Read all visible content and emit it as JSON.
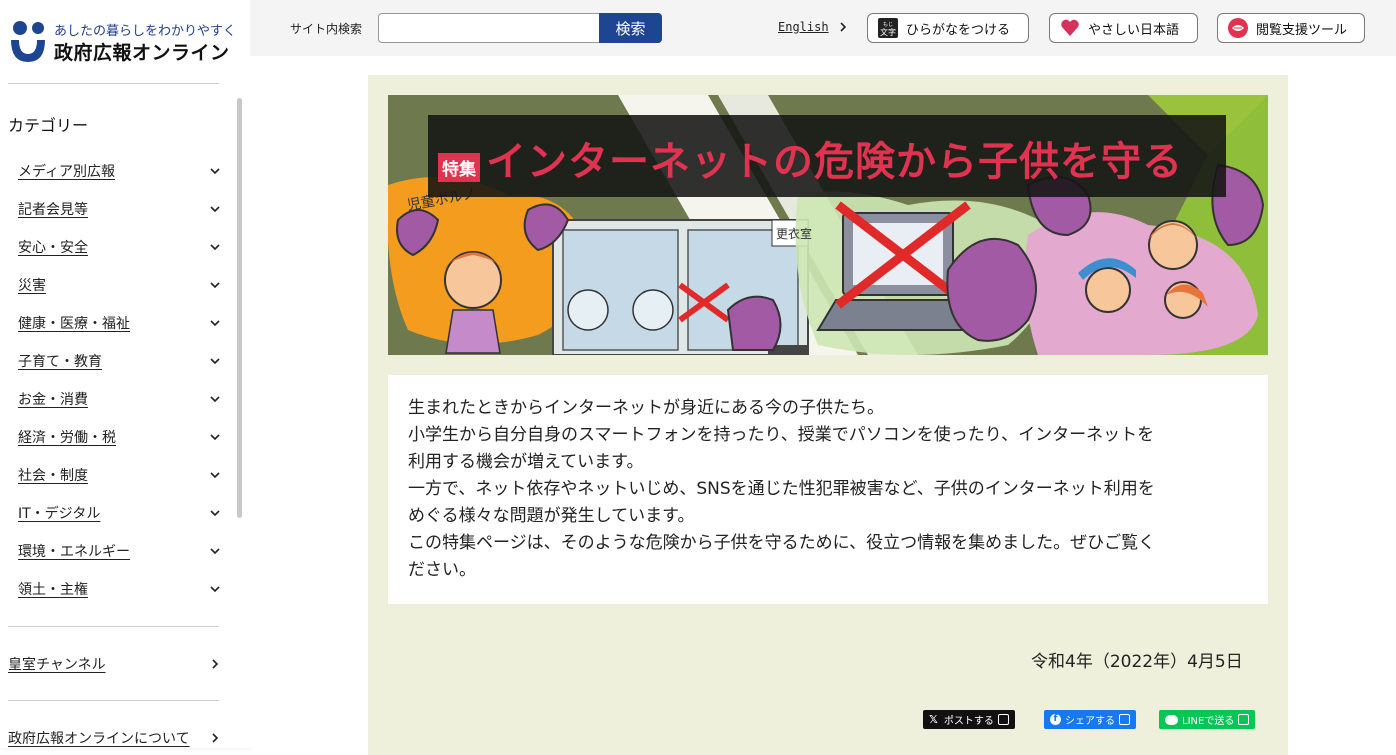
{
  "site": {
    "tagline": "あしたの暮らしをわかりやすく",
    "name": "政府広報オンライン"
  },
  "header": {
    "search_label": "サイト内検索",
    "search_placeholder": "",
    "search_button": "検索",
    "english_link": "English",
    "tools": [
      {
        "label": "ひらがなをつける",
        "icon": "hiragana-moji-icon"
      },
      {
        "label": "やさしい日本語",
        "icon": "heart-icon"
      },
      {
        "label": "閲覧支援ツール",
        "icon": "lips-icon"
      }
    ]
  },
  "sidebar": {
    "category_heading": "カテゴリー",
    "categories": [
      "メディア別広報",
      "記者会見等",
      "安心・安全",
      "災害",
      "健康・医療・福祉",
      "子育て・教育",
      "お金・消費",
      "経済・労働・税",
      "社会・制度",
      "IT・デジタル",
      "環境・エネルギー",
      "領土・主権"
    ],
    "imperial_channel": "皇室チャンネル",
    "about": "政府広報オンラインについて"
  },
  "banner": {
    "badge": "特集",
    "title": "インターネットの危険から子供を守る",
    "sign_left": "児童ポルノ",
    "sign_mid": "更衣室"
  },
  "intro": {
    "lines": [
      "生まれたときからインターネットが身近にある今の子供たち。",
      "小学生から自分自身のスマートフォンを持ったり、授業でパソコンを使ったり、インターネットを",
      "利用する機会が増えています。",
      "一方で、ネット依存やネットいじめ、SNSを通じた性犯罪被害など、子供のインターネット利用を",
      "めぐる様々な問題が発生しています。",
      "この特集ページは、そのような危険から子供を守るために、役立つ情報を集めました。ぜひご覧く",
      "ださい。"
    ]
  },
  "date": "令和4年（2022年）4月5日",
  "share": {
    "x_post": "ポストする",
    "facebook_share": "シェアする",
    "line_send": "LINEで送る"
  },
  "colors": {
    "brand_blue": "#1d4591",
    "banner_red": "#e0334f",
    "card_bg": "#eff0dc",
    "line_green": "#06c755",
    "facebook_blue": "#1877f2"
  }
}
